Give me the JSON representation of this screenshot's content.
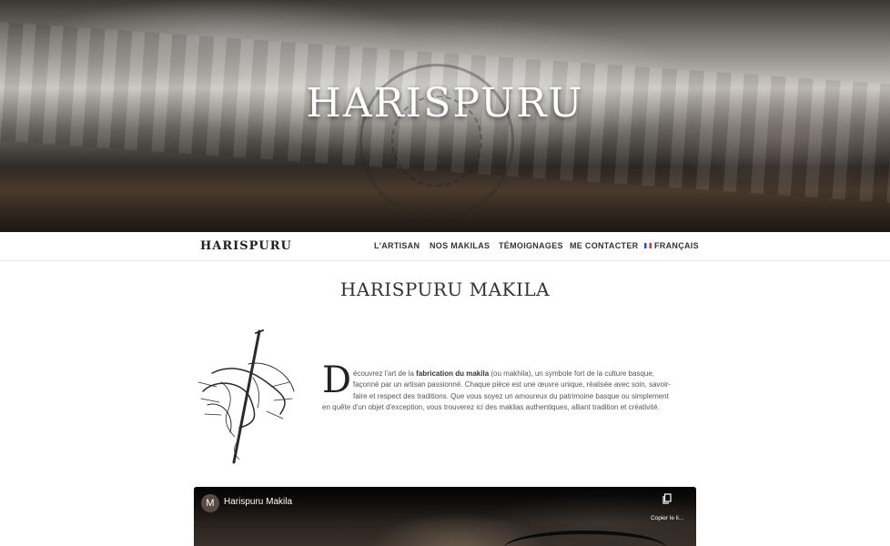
{
  "hero": {
    "title": "HARISPURU"
  },
  "nav": {
    "logo": "HARISPURU",
    "items": [
      "L'ARTISAN",
      "NOS MAKILAS",
      "TÉMOIGNAGES",
      "ME CONTACTER"
    ],
    "language": "FRANÇAIS"
  },
  "page": {
    "title": "HARISPURU MAKILA"
  },
  "intro": {
    "dropcap": "D",
    "line1_before": "écouvrez l'art de la ",
    "line1_bold": "fabrication du makila",
    "line1_after": " (ou makhila), un symbole fort de la culture basque,",
    "line2": "façonné par un artisan passionné. Chaque pièce est une œuvre unique, réalisée avec soin, savoir-",
    "line3": "faire et respect des traditions. Que vous soyez un amoureux du patrimoine basque ou simplement",
    "line4": "en quête d'un objet d'exception, vous trouverez ici des makilas authentiques, alliant tradition et créativité."
  },
  "video": {
    "channel_initial": "M",
    "title": "Harispuru Makila",
    "copy_label": "Copier le li..."
  }
}
